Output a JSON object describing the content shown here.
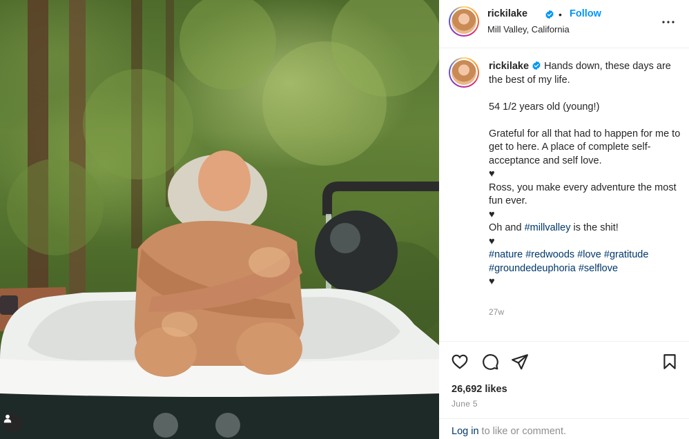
{
  "post": {
    "author": "rickilake",
    "follow_label": "Follow",
    "separator": "•",
    "location": "Mill Valley, California",
    "caption": {
      "line1": "Hands down, these days are the best of my life.",
      "line2": "54 1/2 years old (young!)",
      "line3": "Grateful for all that had to happen for me to get to here. A place of complete self-acceptance and self love.",
      "heart": "♥",
      "line4": "Ross, you make every adventure the most fun ever.",
      "line5_prefix": "Oh and ",
      "line5_tag": "#millvalley",
      "line5_suffix": " is the shit!",
      "hashtags": [
        "#nature",
        "#redwoods",
        "#love",
        "#gratitude",
        "#groundedeuphoria",
        "#selflove"
      ]
    },
    "timestamp": "27w",
    "likes": "26,692 likes",
    "date": "June 5",
    "login_link": "Log in",
    "login_suffix": " to like or comment."
  },
  "icons": {
    "verified": "verified-badge-icon",
    "more": "more-options-icon",
    "like": "heart-outline-icon",
    "comment": "comment-bubble-icon",
    "share": "paper-plane-icon",
    "save": "bookmark-icon",
    "profile": "person-icon"
  },
  "colors": {
    "accent": "#0095f6",
    "hashtag": "#00376b",
    "muted": "#8e8e8e",
    "text": "#262626"
  }
}
